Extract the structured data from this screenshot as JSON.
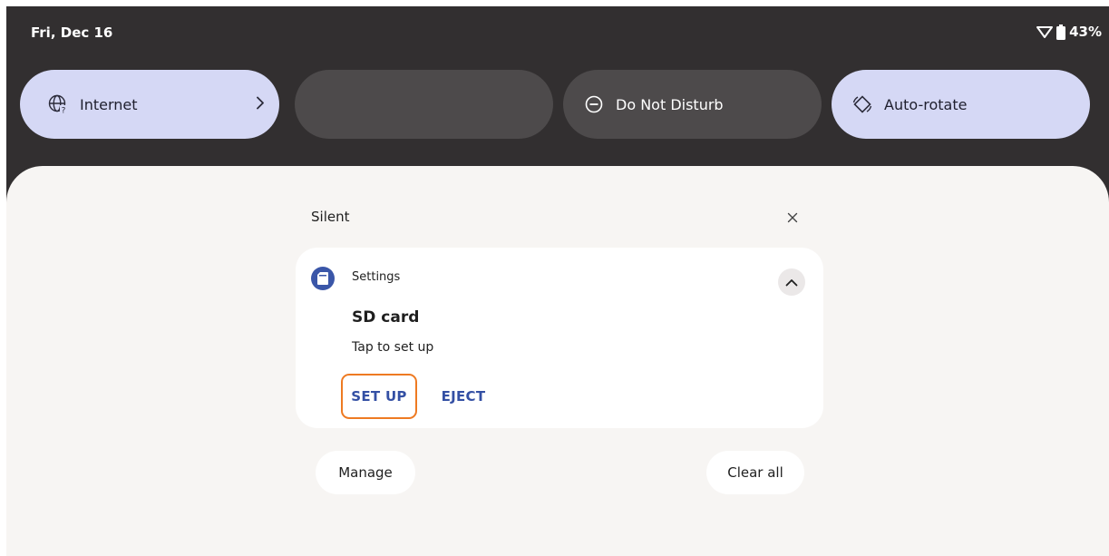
{
  "status_bar": {
    "date": "Fri, Dec 16",
    "battery_percent": "43%",
    "icons": [
      "wifi-icon",
      "battery-icon"
    ]
  },
  "quick_settings": {
    "tiles": [
      {
        "label": "Internet",
        "icon": "internet-icon",
        "active": true,
        "has_chevron": true
      },
      {
        "label": "",
        "icon": "",
        "active": false
      },
      {
        "label": "Do Not Disturb",
        "icon": "do-not-disturb-icon",
        "active": false
      },
      {
        "label": "Auto-rotate",
        "icon": "auto-rotate-icon",
        "active": true
      }
    ]
  },
  "notification_section": {
    "header": "Silent",
    "close_icon": "close-icon",
    "notification": {
      "app_name": "Settings",
      "app_icon": "sd-card-icon",
      "title": "SD card",
      "text": "Tap to set up",
      "actions": [
        "SET UP",
        "EJECT"
      ],
      "expand_icon": "chevron-up-icon"
    }
  },
  "footer": {
    "manage_label": "Manage",
    "clear_all_label": "Clear all"
  },
  "colors": {
    "shade_background": "#322f30",
    "tile_active": "#d5d8f5",
    "tile_inactive": "#4d4a4b",
    "panel_background": "#f7f5f3",
    "action_text": "#3450a4",
    "focus_outline": "#ee7a22",
    "app_icon_background": "#3a56a8"
  }
}
